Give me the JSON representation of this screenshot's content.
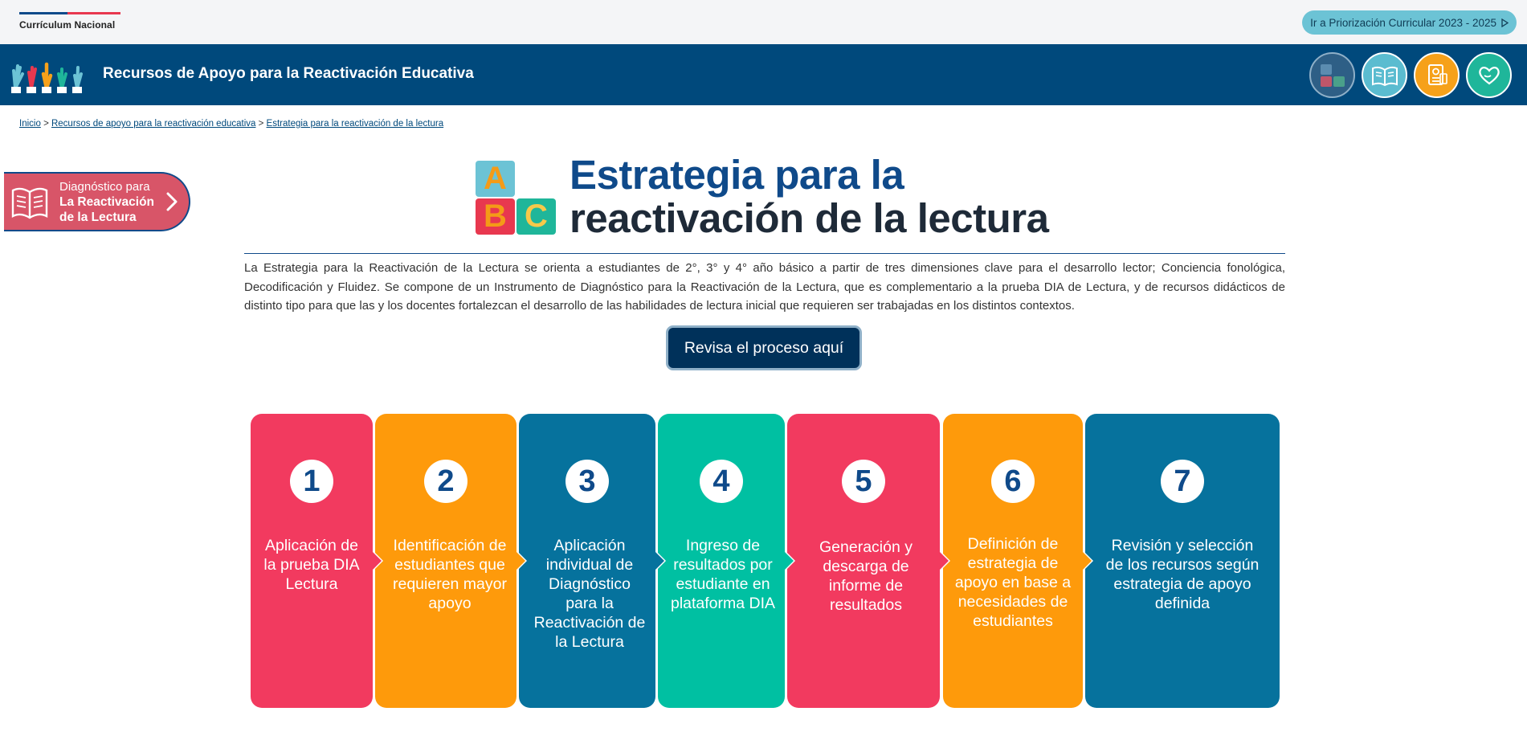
{
  "topbar": {
    "brand": "Currículum Nacional",
    "priorizacion_label": "Ir a Priorización Curricular 2023 - 2025"
  },
  "header": {
    "title": "Recursos de Apoyo para la Reactivación Educativa",
    "icons": [
      "abc-blocks-icon",
      "open-book-icon",
      "document-icon",
      "heart-hand-icon"
    ]
  },
  "breadcrumb": {
    "items": [
      "Inicio",
      "Recursos de apoyo para la reactivación educativa",
      "Estrategia para la reactivación de la lectura"
    ],
    "separator": ">"
  },
  "side_badge": {
    "line1": "Diagnóstico para",
    "line2": "La Reactivación",
    "line3": "de la Lectura"
  },
  "title": {
    "abc": [
      "A",
      "B",
      "C"
    ],
    "line1": "Estrategia para la",
    "line2": "reactivación de la lectura"
  },
  "intro": "La Estrategia para la Reactivación de la Lectura se orienta a estudiantes de 2°, 3° y 4° año básico a partir de tres dimensiones clave para el desarrollo lector; Conciencia fonológica, Decodificación y Fluidez. Se compone de un Instrumento de Diagnóstico para la Reactivación de la Lectura, que es complementario a la prueba DIA de Lectura, y de recursos didácticos de distinto tipo para que las y los docentes fortalezcan el desarrollo de las habilidades de lectura inicial que requieren ser trabajadas en los distintos contextos.",
  "cta_label": "Revisa el proceso aquí",
  "steps": [
    {
      "number": "1",
      "text": "Aplicación de la prueba DIA Lectura",
      "color": "#f23a5f"
    },
    {
      "number": "2",
      "text": "Identificación de estudiantes que requieren mayor apoyo",
      "color": "#fe9a0b"
    },
    {
      "number": "3",
      "text": "Aplicación individual de Diagnóstico para la Reactivación de la Lectura",
      "color": "#06729d"
    },
    {
      "number": "4",
      "text": "Ingreso de resultados por estudiante en plataforma DIA",
      "color": "#00c0a2"
    },
    {
      "number": "5",
      "text": "Generación y descarga de informe de resultados",
      "color": "#f23a5f"
    },
    {
      "number": "6",
      "text": "Definición de estrategia de apoyo en base a necesidades de estudiantes",
      "color": "#fe9a0b"
    },
    {
      "number": "7",
      "text": "Revisión y selección de los recursos según estrategia de apoyo definida",
      "color": "#06729d"
    }
  ],
  "colors": {
    "header_bg": "#00497c",
    "title_blue": "#0f4a8a",
    "cta_bg": "#00315a",
    "badge_bg": "#d85568"
  }
}
